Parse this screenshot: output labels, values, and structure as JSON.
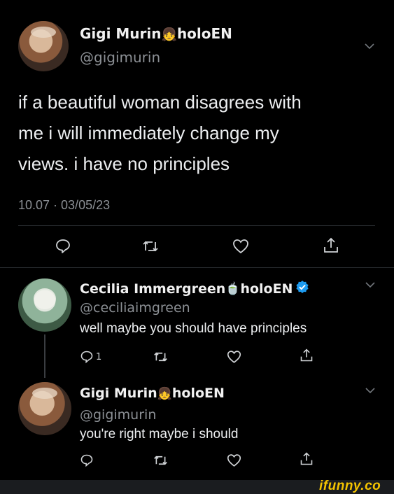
{
  "main_tweet": {
    "display_name": "Gigi Murin",
    "name_emoji": "👧",
    "name_suffix": "holoEN",
    "handle": "@gigimurin",
    "text_lines": [
      "if a beautiful woman disagrees with",
      "me i will immediately change my",
      "views. i have no principles"
    ],
    "timestamp": "10.07 · 03/05/23",
    "icons": [
      "reply-icon",
      "retweet-icon",
      "like-icon",
      "share-icon"
    ]
  },
  "reply_1": {
    "display_name": "Cecilia Immergreen",
    "name_emoji": "🍵",
    "name_suffix": "holoEN",
    "verified": true,
    "handle": "@ceciliaimgreen",
    "text": "well maybe you should have principles",
    "reply_count": "1"
  },
  "reply_2": {
    "display_name": "Gigi Murin",
    "name_emoji": "👧",
    "name_suffix": "holoEN",
    "handle": "@gigimurin",
    "text": "you're right maybe i should"
  },
  "watermark": {
    "text": "ifunny.co"
  },
  "colors": {
    "background": "#000000",
    "text": "#e7e9ea",
    "secondary": "#8b8f94",
    "verified": "#1d9bf0",
    "watermark": "#f5c400"
  }
}
